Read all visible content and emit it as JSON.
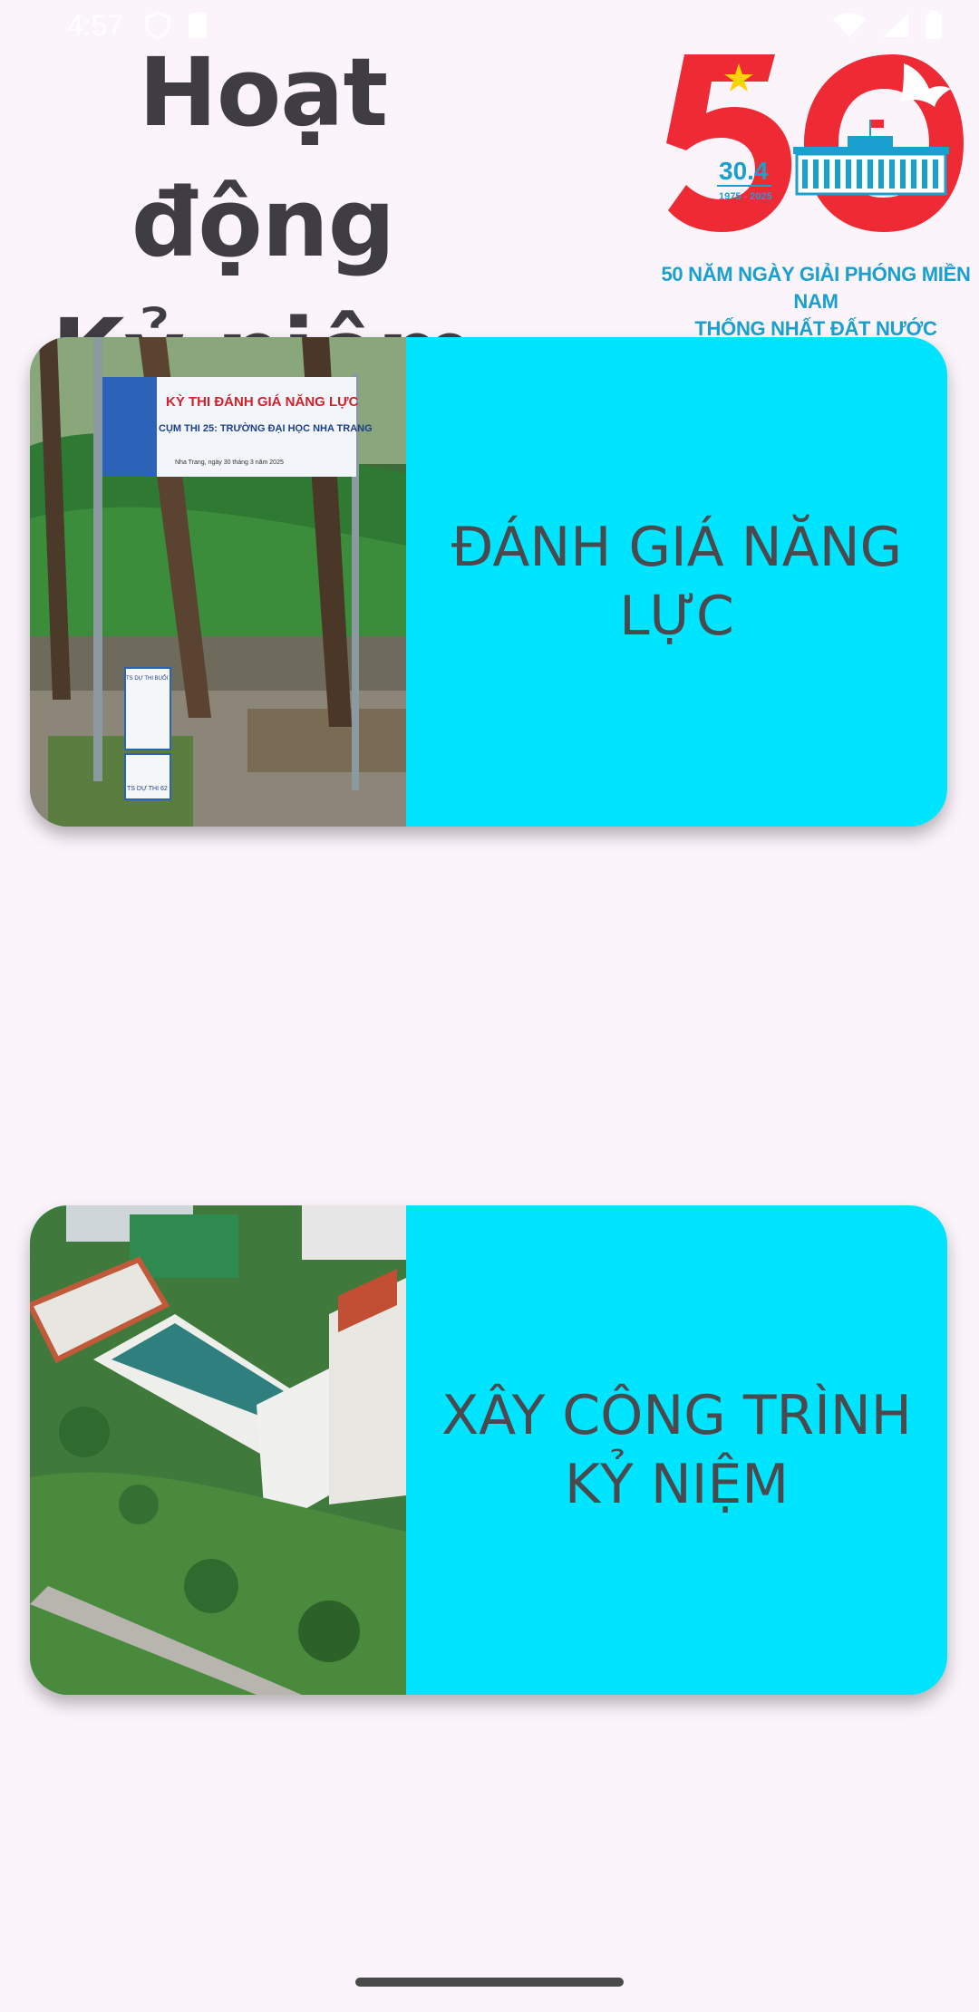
{
  "status_bar": {
    "time": "4:57",
    "icons": [
      "shield-icon",
      "sim-card-icon",
      "wifi-icon",
      "cellular-signal-icon",
      "battery-icon"
    ]
  },
  "header": {
    "title_line1": "Hoạt động",
    "title_line2": "Kỷ niệm",
    "logo": {
      "big_number": "50",
      "date": "30.4",
      "years": "1975 - 2025",
      "caption_line1": "50 NĂM NGÀY GIẢI PHÓNG MIỀN NAM",
      "caption_line2": "THỐNG NHẤT ĐẤT NƯỚC",
      "colors": {
        "red": "#ee2b35",
        "blue": "#1aa0cf",
        "star": "#ffd200"
      }
    }
  },
  "cards": [
    {
      "label": "ĐÁNH GIÁ NĂNG LỰC",
      "image_banner_title": "KỲ THI ĐÁNH GIÁ NĂNG LỰC",
      "image_banner_sub": "CỤM THI 25: TRƯỜNG ĐẠI HỌC NHA TRANG",
      "image_banner_date": "Nha Trang, ngày 30 tháng 3 năm 2025",
      "sign_top": "TS DỰ THI BUỔI",
      "sign_bottom": "TS DỰ THI 62",
      "background": "#00e5ff"
    },
    {
      "label": "XÂY CÔNG TRÌNH KỶ NIỆM",
      "background": "#00e5ff"
    }
  ]
}
